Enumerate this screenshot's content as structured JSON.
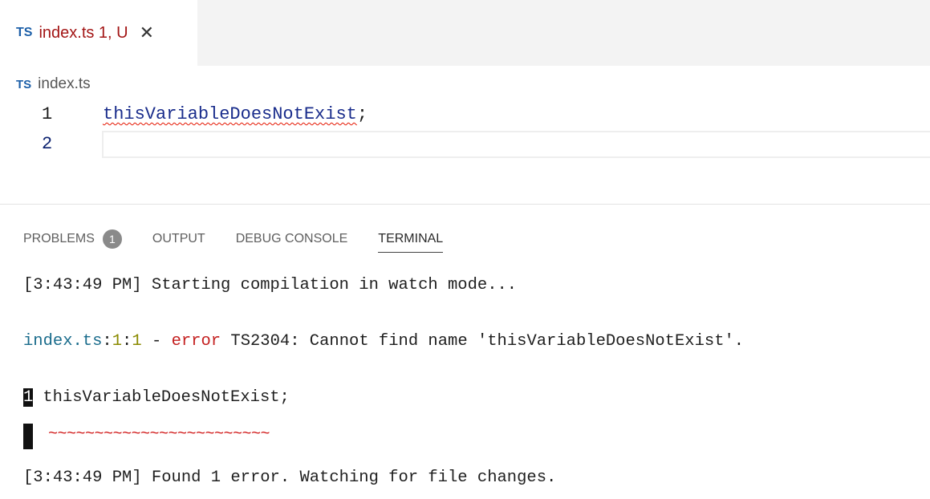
{
  "tab": {
    "badge": "TS",
    "name": "index.ts 1, U",
    "close": "✕"
  },
  "breadcrumb": {
    "badge": "TS",
    "file": "index.ts"
  },
  "editor": {
    "lines": [
      {
        "num": "1",
        "code": "thisVariableDoesNotExist",
        "punct": ";"
      },
      {
        "num": "2",
        "code": "",
        "punct": ""
      }
    ]
  },
  "panel": {
    "tabs": [
      {
        "label": "PROBLEMS",
        "badge": "1"
      },
      {
        "label": "OUTPUT"
      },
      {
        "label": "DEBUG CONSOLE"
      },
      {
        "label": "TERMINAL",
        "active": true
      }
    ]
  },
  "terminal": {
    "line1": "[3:43:49 PM] Starting compilation in watch mode...",
    "error": {
      "file": "index.ts",
      "sep1": ":",
      "line": "1",
      "sep2": ":",
      "col": "1",
      "dash": " - ",
      "keyword": "error",
      "message": " TS2304: Cannot find name 'thisVariableDoesNotExist'."
    },
    "snippet": {
      "num": "1",
      "code": "thisVariableDoesNotExist;",
      "tildes": "~~~~~~~~~~~~~~~~~~~~~~~~"
    },
    "line_last": "[3:43:49 PM] Found 1 error. Watching for file changes."
  }
}
